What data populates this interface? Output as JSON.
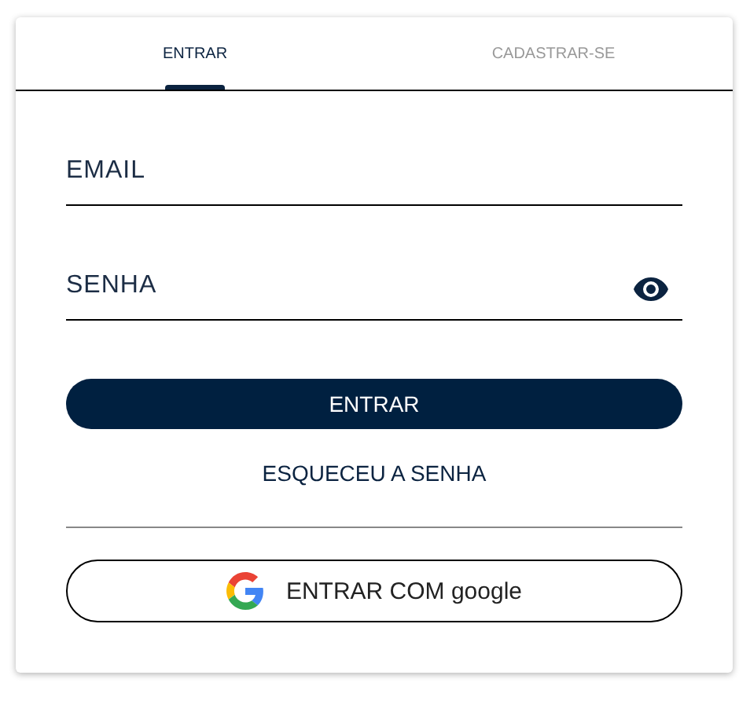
{
  "tabs": [
    {
      "label": "ENTRAR",
      "selected": true
    },
    {
      "label": "CADASTRAR-SE",
      "selected": false
    }
  ],
  "email": {
    "placeholder": "EMAIL"
  },
  "password": {
    "placeholder": "SENHA"
  },
  "submit": "ENTRAR",
  "forgot": "ESQUECEU A SENHA",
  "google_button": "ENTRAR COM google"
}
